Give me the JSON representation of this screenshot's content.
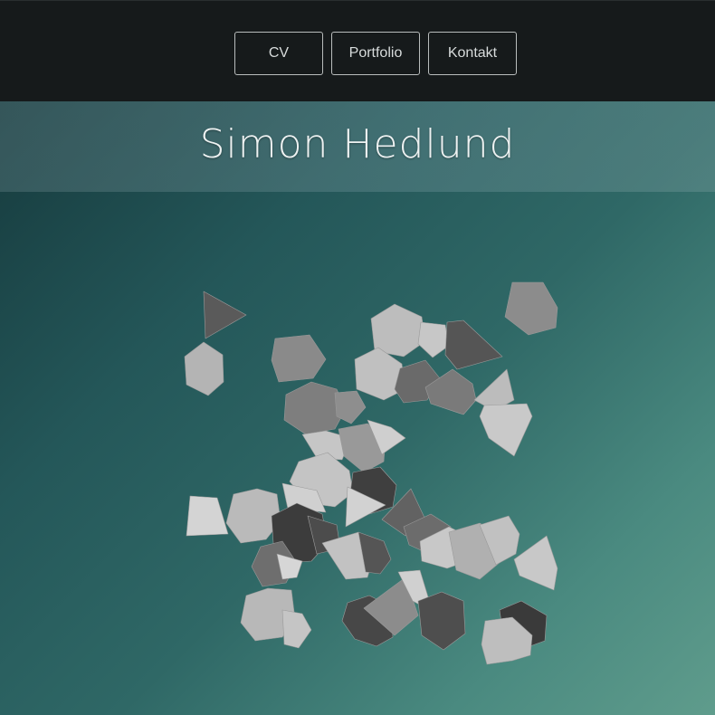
{
  "nav": {
    "items": [
      {
        "label": "CV"
      },
      {
        "label": "Portfolio"
      },
      {
        "label": "Kontakt"
      }
    ]
  },
  "hero": {
    "title": "Simon Hedlund"
  },
  "colors": {
    "topbar": "#161a1b",
    "hero_start": "#163a3d",
    "hero_end": "#5f9c8c",
    "shape_light": "#bdbdbd",
    "shape_mid": "#8a8a8a",
    "shape_dark": "#4a4a4a"
  }
}
